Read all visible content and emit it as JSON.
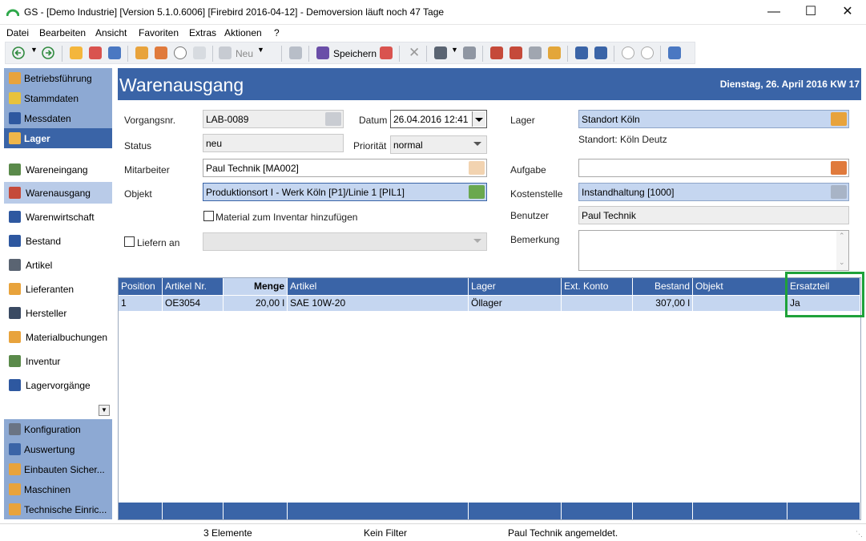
{
  "window": {
    "title": "GS - [Demo Industrie]  [Version  5.1.0.6006]  [Firebird 2016-04-12] - Demoversion läuft noch 47 Tage"
  },
  "menu": [
    "Datei",
    "Bearbeiten",
    "Ansicht",
    "Favoriten",
    "Extras",
    "Aktionen",
    "?"
  ],
  "toolbar": {
    "new_label": "Neu",
    "save_label": "Speichern"
  },
  "sidebar": {
    "groups_top": [
      {
        "label": "Betriebsführung",
        "icon": "clock-icon"
      },
      {
        "label": "Stammdaten",
        "icon": "folder-icon"
      },
      {
        "label": "Messdaten",
        "icon": "pen-icon"
      },
      {
        "label": "Lager",
        "icon": "warehouse-icon"
      }
    ],
    "items": [
      {
        "label": "Wareneingang"
      },
      {
        "label": "Warenausgang"
      },
      {
        "label": "Warenwirtschaft"
      },
      {
        "label": "Bestand"
      },
      {
        "label": "Artikel"
      },
      {
        "label": "Lieferanten"
      },
      {
        "label": "Hersteller"
      },
      {
        "label": "Materialbuchungen"
      },
      {
        "label": "Inventur"
      },
      {
        "label": "Lagervorgänge"
      }
    ],
    "groups_bottom": [
      {
        "label": "Konfiguration"
      },
      {
        "label": "Auswertung"
      },
      {
        "label": "Einbauten Sicher..."
      },
      {
        "label": "Maschinen"
      },
      {
        "label": "Technische Einric..."
      }
    ]
  },
  "header": {
    "title": "Warenausgang",
    "date": "Dienstag, 26. April 2016  KW 17"
  },
  "form": {
    "vorgangsnr_label": "Vorgangsnr.",
    "vorgangsnr_value": "LAB-0089",
    "datum_label": "Datum",
    "datum_value": "26.04.2016 12:41",
    "lager_label": "Lager",
    "lager_value": "Standort Köln",
    "lager_sub": "Standort: Köln Deutz",
    "status_label": "Status",
    "status_value": "neu",
    "prioritaet_label": "Priorität",
    "prioritaet_value": "normal",
    "mitarbeiter_label": "Mitarbeiter",
    "mitarbeiter_value": "Paul Technik [MA002]",
    "aufgabe_label": "Aufgabe",
    "aufgabe_value": "",
    "objekt_label": "Objekt",
    "objekt_value": "Produktionsort I - Werk Köln [P1]/Linie 1 [PIL1]",
    "kostenstelle_label": "Kostenstelle",
    "kostenstelle_value": "Instandhaltung [1000]",
    "inventar_label": "Material zum Inventar hinzufügen",
    "benutzer_label": "Benutzer",
    "benutzer_value": "Paul Technik",
    "liefern_label": "Liefern an",
    "bemerkung_label": "Bemerkung"
  },
  "grid": {
    "columns": [
      "Position",
      "Artikel Nr.",
      "Menge",
      "Artikel",
      "Lager",
      "Ext. Konto",
      "Bestand",
      "Objekt",
      "Ersatzteil"
    ],
    "rows": [
      [
        "1",
        "OE3054",
        "20,00 l",
        "SAE 10W-20",
        "Öllager",
        "",
        "307,00 l",
        "",
        "Ja"
      ]
    ]
  },
  "statusbar": {
    "count": "3 Elemente",
    "filter": "Kein Filter",
    "user": "Paul Technik angemeldet."
  },
  "colors": {
    "accent": "#3a64a7",
    "nav_group": "#8da9d3",
    "selection": "#c5d6f0",
    "highlight": "#1fa23a"
  }
}
